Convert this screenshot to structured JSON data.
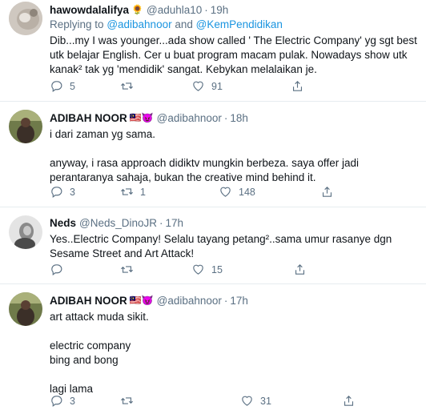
{
  "tweets": [
    {
      "name": "hawowdalalifya",
      "name_emoji": "🌻",
      "handle": "@aduhla10",
      "separator": "·",
      "time": "19h",
      "replying_prefix": "Replying to",
      "replying_to_1": "@adibahnoor",
      "replying_and": "and",
      "replying_to_2": "@KemPendidikan",
      "text": "Dib...my I was younger...ada show  called ' The Electric Company' yg sgt best utk belajar English. Cer u buat program macam pulak. Nowadays show utk kanak² tak yg 'mendidik' sangat. Kebykan melalaikan je.",
      "replies": "5",
      "retweets": "",
      "likes": "91"
    },
    {
      "name": "ADIBAH NOOR",
      "name_emoji": "🇲🇾😈",
      "handle": "@adibahnoor",
      "separator": "·",
      "time": "18h",
      "text": "i dari zaman yg sama.\n\nanyway, i rasa approach didiktv mungkin berbeza. saya offer jadi perantaranya sahaja, bukan the creative mind behind it.",
      "replies": "3",
      "retweets": "1",
      "likes": "148"
    },
    {
      "name": "Neds",
      "handle": "@Neds_DinoJR",
      "separator": "·",
      "time": "17h",
      "text": "Yes..Electric Company! Selalu tayang petang²..sama umur rasanye dgn Sesame Street and Art Attack!",
      "replies": "",
      "retweets": "",
      "likes": "15"
    },
    {
      "name": "ADIBAH NOOR",
      "name_emoji": "🇲🇾😈",
      "handle": "@adibahnoor",
      "separator": "·",
      "time": "17h",
      "text": "art attack muda sikit.\n\nelectric company\nbing and bong\n\nlagi lama",
      "replies": "3",
      "retweets": "",
      "likes": "31"
    }
  ]
}
